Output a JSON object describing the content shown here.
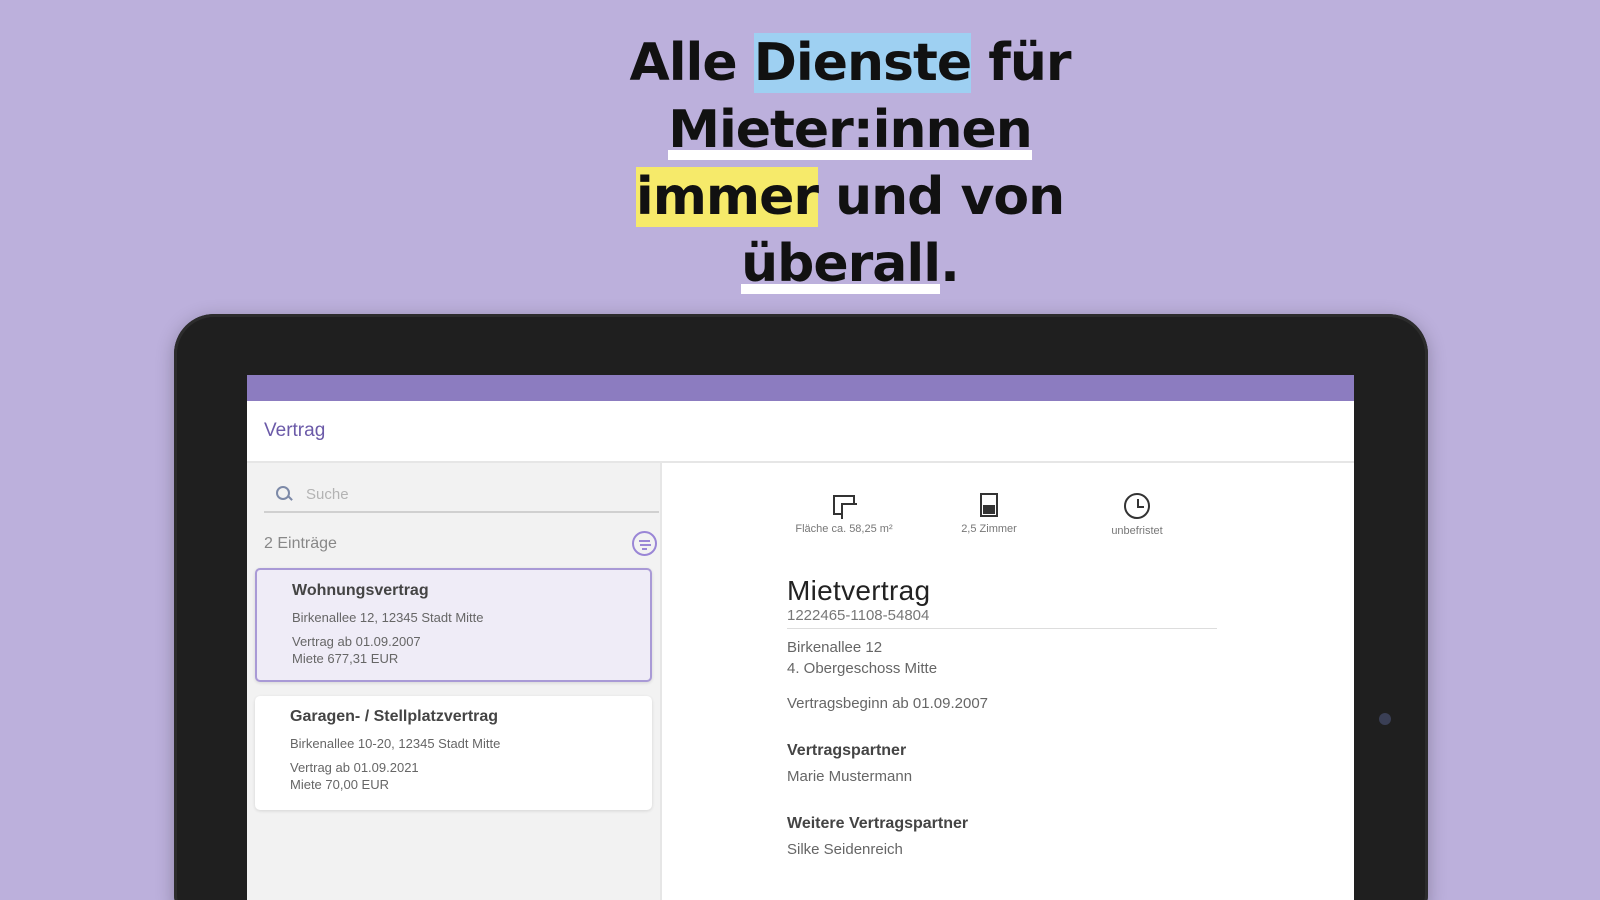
{
  "headline": {
    "l1_pre": "Alle ",
    "l1_hl": "Dienste",
    "l1_post": " für",
    "l2_hl": "Mieter:innen",
    "l3_hl": "immer",
    "l3_post": " und von",
    "l4_hl": "überall",
    "l4_post": "."
  },
  "app": {
    "title": "Vertrag",
    "accent": "#8c7cc0"
  },
  "sidebar": {
    "search_placeholder": "Suche",
    "count": "2 Einträge",
    "items": [
      {
        "title": "Wohnungsvertrag",
        "address": "Birkenallee 12, 12345 Stadt Mitte",
        "start": "Vertrag ab 01.09.2007",
        "rent": "Miete 677,31 EUR"
      },
      {
        "title": "Garagen- / Stellplatzvertrag",
        "address": "Birkenallee 10-20, 12345 Stadt Mitte",
        "start": "Vertrag ab 01.09.2021",
        "rent": "Miete 70,00 EUR"
      }
    ]
  },
  "detail": {
    "facts": [
      {
        "label": "Fläche ca. 58,25 m²",
        "icon": "area-icon"
      },
      {
        "label": "2,5 Zimmer",
        "icon": "rooms-icon"
      },
      {
        "label": "unbefristet",
        "icon": "clock-icon"
      }
    ],
    "title": "Mietvertrag",
    "number": "1222465-1108-54804",
    "address_line1": "Birkenallee 12",
    "address_line2": "4. Obergeschoss Mitte",
    "start": "Vertragsbeginn ab 01.09.2007",
    "partner_heading": "Vertragspartner",
    "partner": "Marie Mustermann",
    "more_partners_heading": "Weitere Vertragspartner",
    "more_partner": "Silke Seidenreich"
  }
}
